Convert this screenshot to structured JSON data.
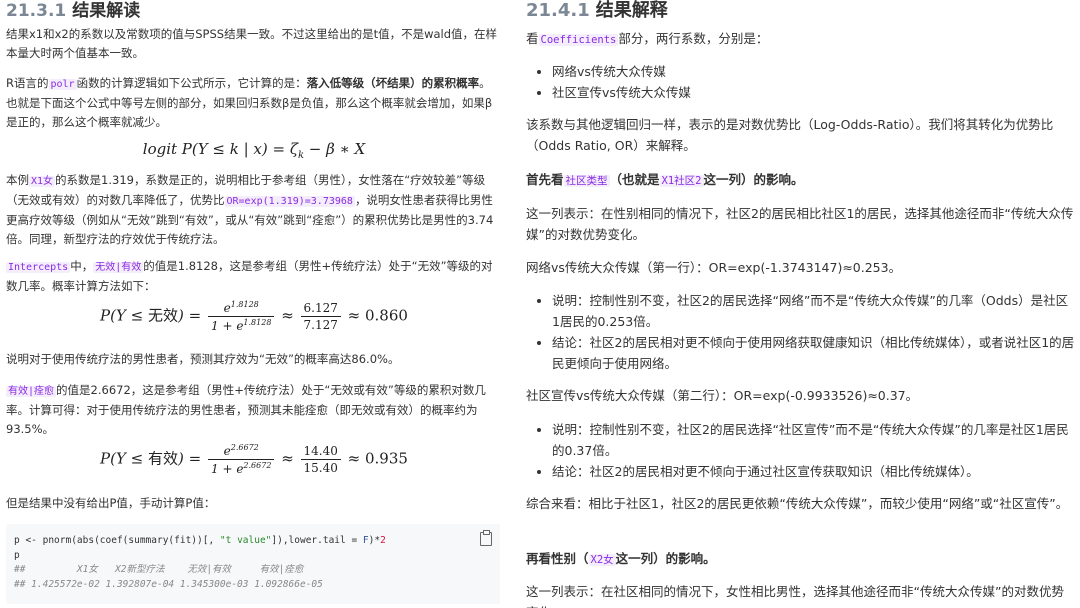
{
  "left": {
    "heading_num": "21.3.1",
    "heading_title": "结果解读",
    "p1": "结果x1和x2的系数以及常数项的值与SPSS结果一致。不过这里给出的是t值，不是wald值，在样本量大时两个值基本一致。",
    "p2_a": "R语言的",
    "p2_code": "polr",
    "p2_b": "函数的计算逻辑如下公式所示，它计算的是：",
    "p2_bold": "落入低等级（坏结果）的累积概率",
    "p2_c": "。也就是下面这个公式中等号左侧的部分，如果回归系数β是负值，那么这个概率就会增加，如果β是正的，那么这个概率就减少。",
    "formula1_lhs": "logit P(Y ≤ k | x) = ζ",
    "formula1_sub": "k",
    "formula1_rhs": " − β ∗ X",
    "p3_a": "本例",
    "p3_code1": "X1女",
    "p3_b": "的系数是1.319，系数是正的，说明相比于参考组（男性），女性落在“疗效较差”等级（无效或有效）的对数几率降低了，优势比",
    "p3_code2": "OR=exp(1.319)=3.73968",
    "p3_c": "，说明女性患者获得比男性更高疗效等级（例如从“无效”跳到“有效”，或从“有效”跳到“痊愈”）的累积优势比是男性的3.74倍。同理，新型疗法的疗效优于传统疗法。",
    "p4_code1": "Intercepts",
    "p4_a": "中，",
    "p4_code2": "无效|有效",
    "p4_b": "的值是1.8128，这是参考组（男性+传统疗法）处于“无效”等级的对数几率。概率计算方法如下：",
    "formula2_lhs": "P(Y ≤ ",
    "formula2_word": "无效",
    "formula2_mid": ") =",
    "formula2_num": "e",
    "formula2_num_sup": "1.8128",
    "formula2_den": "1 + e",
    "formula2_den_sup": "1.8128",
    "formula2_approx1": " ≈ ",
    "formula2_fnum": "6.127",
    "formula2_fden": "7.127",
    "formula2_result": " ≈ 0.860",
    "p5": "说明对于使用传统疗法的男性患者，预测其疗效为“无效”的概率高达86.0%。",
    "p6_code": "有效|痊愈",
    "p6_a": "的值是2.6672，这是参考组（男性+传统疗法）处于“无效或有效”等级的累积对数几率。计算可得：对于使用传统疗法的男性患者，预测其未能痊愈（即无效或有效）的概率约为93.5%。",
    "formula3_lhs": "P(Y ≤ ",
    "formula3_word": "有效",
    "formula3_mid": ") =",
    "formula3_num": "e",
    "formula3_num_sup": "2.6672",
    "formula3_den": "1 + e",
    "formula3_den_sup": "2.6672",
    "formula3_approx1": " ≈ ",
    "formula3_fnum": "14.40",
    "formula3_fden": "15.40",
    "formula3_result": " ≈ 0.935",
    "p7": "但是结果中没有给出P值，手动计算P值：",
    "code_l1_a": "p <- pnorm(abs(coef(summary(fit))[, ",
    "code_l1_str": "\"t value\"",
    "code_l1_b": "]),lower.tail = ",
    "code_l1_kw": "F",
    "code_l1_c": ")*",
    "code_l1_num": "2",
    "code_l2": "p",
    "code_l3": "##         X1女   X2新型疗法    无效|有效     有效|痊愈",
    "code_l4": "## 1.425572e-02 1.392807e-04 1.345300e-03 1.092866e-05"
  },
  "right": {
    "heading_num": "21.4.1",
    "heading_title": "结果解释",
    "p1_a": "看",
    "p1_code": "Coefficients",
    "p1_b": "部分，两行系数，分别是：",
    "bullets1": [
      "网络vs传统大众传媒",
      "社区宣传vs传统大众传媒"
    ],
    "p2": "该系数与其他逻辑回归一样，表示的是对数优势比（Log-Odds-Ratio）。我们将其转化为优势比（Odds Ratio, OR）来解释。",
    "p3_a": "首先看",
    "p3_code1": "社区类型",
    "p3_b": "（也就是",
    "p3_code2": "X1社区2",
    "p3_c": "这一列）的影响。",
    "p4": "这一列表示：在性别相同的情况下，社区2的居民相比社区1的居民，选择其他途径而非“传统大众传媒”的对数优势变化。",
    "p5": "网络vs传统大众传媒（第一行）：OR=exp(-1.3743147)≈0.253。",
    "bullets2": [
      "说明：控制性别不变，社区2的居民选择“网络”而不是“传统大众传媒”的几率（Odds）是社区1居民的0.253倍。",
      "结论：社区2的居民相对更不倾向于使用网络获取健康知识（相比传统媒体），或者说社区1的居民更倾向于使用网络。"
    ],
    "p6": "社区宣传vs传统大众传媒（第二行）：OR=exp(-0.9933526)≈0.37。",
    "bullets3": [
      "说明：控制性别不变，社区2的居民选择“社区宣传”而不是“传统大众传媒”的几率是社区1居民的0.37倍。",
      "结论：社区2的居民相对更不倾向于通过社区宣传获取知识（相比传统媒体）。"
    ],
    "p7": "综合来看：相比于社区1，社区2的居民更依赖“传统大众传媒”，而较少使用“网络”或“社区宣传”。",
    "p8_a": "再看性别（",
    "p8_code": "X2女",
    "p8_b": "这一列）的影响。",
    "p9": "这一列表示：在社区相同的情况下，女性相比男性，选择其他途径而非“传统大众传媒”的对数优势变化。"
  }
}
